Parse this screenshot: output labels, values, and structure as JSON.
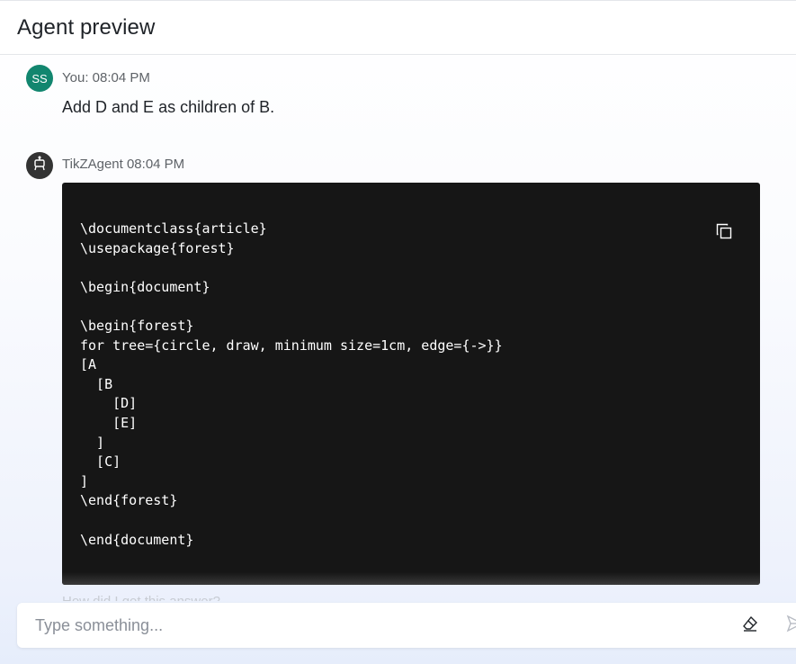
{
  "header": {
    "title": "Agent preview"
  },
  "messages": [
    {
      "avatar_initials": "SS",
      "avatar_color": "#12866f",
      "meta": "You: 08:04 PM",
      "text": "Add D and E as children of B."
    },
    {
      "avatar_icon": "robot-icon",
      "avatar_color": "#333333",
      "meta": "TikZAgent 08:04 PM",
      "code_lines": [
        "\\documentclass{article}",
        "\\usepackage{forest}",
        "",
        "\\begin{document}",
        "",
        "\\begin{forest}",
        "for tree={circle, draw, minimum size=1cm, edge={->}}",
        "[A",
        "  [B",
        "    [D]",
        "    [E]",
        "  ]",
        "  [C]",
        "]",
        "\\end{forest}",
        "",
        "\\end{document}"
      ],
      "copy_icon": "copy-icon",
      "footer_text": "How did I get this answer?"
    }
  ],
  "input": {
    "placeholder": "Type something..."
  },
  "icons": {
    "clear": "eraser-icon",
    "send": "send-icon"
  }
}
